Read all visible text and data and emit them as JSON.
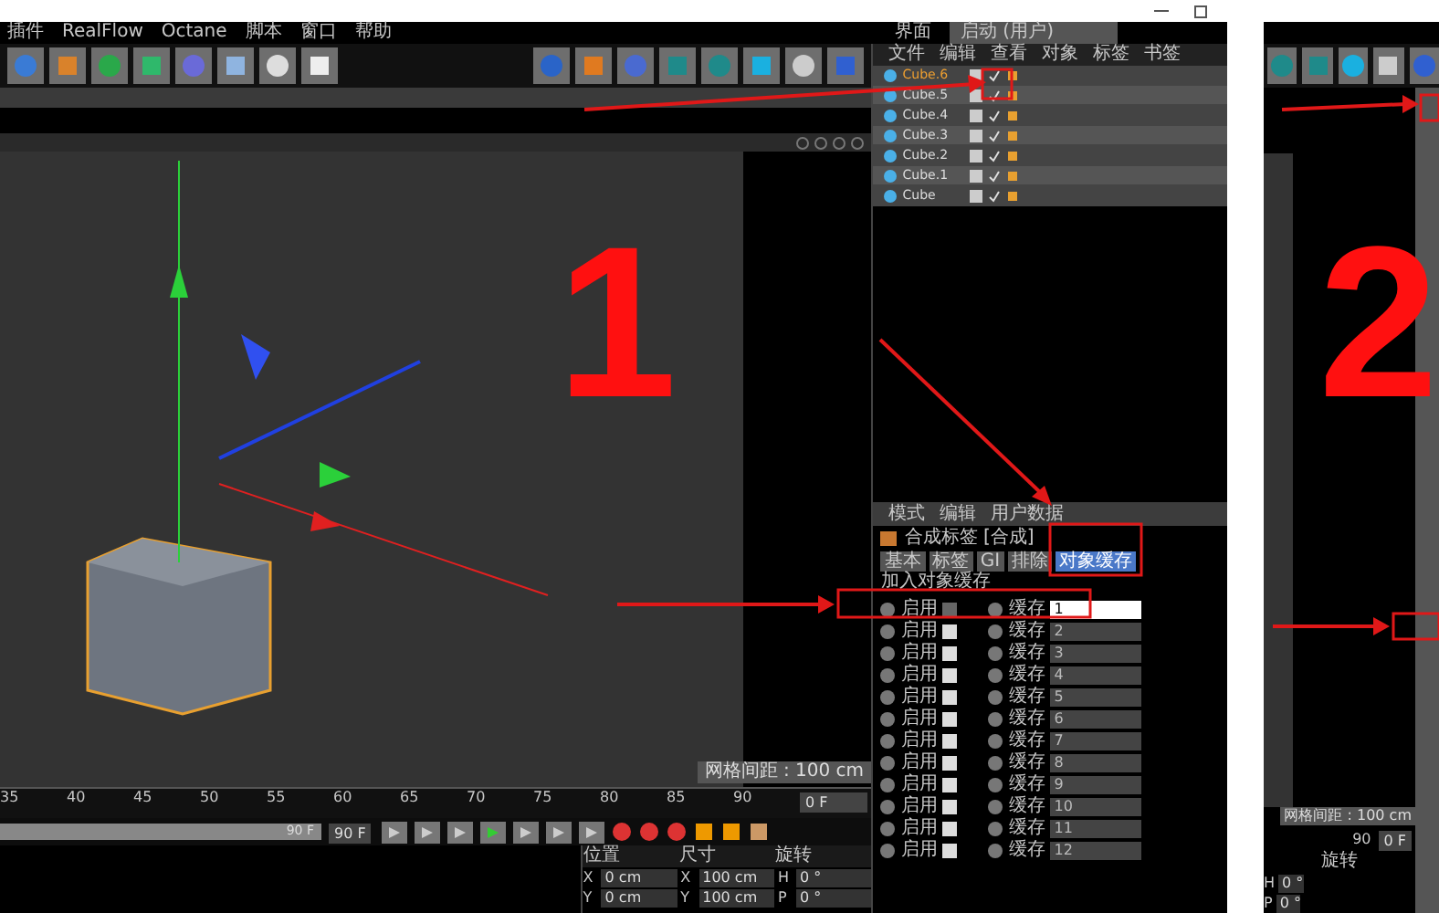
{
  "menu_bar": {
    "items": [
      "插件",
      "RealFlow",
      "Octane",
      "脚本",
      "窗口",
      "帮助"
    ],
    "layout_label": "界面",
    "layout_value": "启动 (用户)"
  },
  "object_manager": {
    "tabs": [
      "文件",
      "编辑",
      "查看",
      "对象",
      "标签",
      "书签"
    ],
    "objects": [
      {
        "name": "Cube.6",
        "selected": true
      },
      {
        "name": "Cube.5",
        "selected": false
      },
      {
        "name": "Cube.4",
        "selected": false
      },
      {
        "name": "Cube.3",
        "selected": false
      },
      {
        "name": "Cube.2",
        "selected": false
      },
      {
        "name": "Cube.1",
        "selected": false
      },
      {
        "name": "Cube",
        "selected": false
      }
    ]
  },
  "viewport": {
    "grid_spacing": "网格间距 : 100 cm"
  },
  "attribute_manager": {
    "menu": [
      "模式",
      "编辑",
      "用户数据"
    ],
    "title": "合成标签 [合成]",
    "tabs": [
      {
        "label": "基本",
        "selected": false
      },
      {
        "label": "标签",
        "selected": false
      },
      {
        "label": "GI",
        "selected": false
      },
      {
        "label": "排除",
        "selected": false
      },
      {
        "label": "对象缓存",
        "selected": true
      }
    ],
    "section": "加入对象缓存",
    "rows": [
      {
        "enable_label": "启用",
        "checked": true,
        "cache_label": "缓存",
        "value": "1",
        "disabled": false
      },
      {
        "enable_label": "启用",
        "checked": false,
        "cache_label": "缓存",
        "value": "2",
        "disabled": true
      },
      {
        "enable_label": "启用",
        "checked": false,
        "cache_label": "缓存",
        "value": "3",
        "disabled": true
      },
      {
        "enable_label": "启用",
        "checked": false,
        "cache_label": "缓存",
        "value": "4",
        "disabled": true
      },
      {
        "enable_label": "启用",
        "checked": false,
        "cache_label": "缓存",
        "value": "5",
        "disabled": true
      },
      {
        "enable_label": "启用",
        "checked": false,
        "cache_label": "缓存",
        "value": "6",
        "disabled": true
      },
      {
        "enable_label": "启用",
        "checked": false,
        "cache_label": "缓存",
        "value": "7",
        "disabled": true
      },
      {
        "enable_label": "启用",
        "checked": false,
        "cache_label": "缓存",
        "value": "8",
        "disabled": true
      },
      {
        "enable_label": "启用",
        "checked": false,
        "cache_label": "缓存",
        "value": "9",
        "disabled": true
      },
      {
        "enable_label": "启用",
        "checked": false,
        "cache_label": "缓存",
        "value": "10",
        "disabled": true
      },
      {
        "enable_label": "启用",
        "checked": false,
        "cache_label": "缓存",
        "value": "11",
        "disabled": true
      },
      {
        "enable_label": "启用",
        "checked": false,
        "cache_label": "缓存",
        "value": "12",
        "disabled": true
      }
    ]
  },
  "timeline": {
    "ticks": [
      "35",
      "40",
      "45",
      "50",
      "55",
      "60",
      "65",
      "70",
      "75",
      "80",
      "85",
      "90"
    ],
    "current_frame": "0 F",
    "range_slider": {
      "level": 1,
      "label": "90 F"
    },
    "end_frame": "90 F"
  },
  "coordinates": {
    "headers": [
      "位置",
      "尺寸",
      "旋转"
    ],
    "rows": [
      {
        "axis": "X",
        "position": "0 cm",
        "size_axis": "X",
        "size": "100 cm",
        "rotation_axis": "H",
        "rotation": "0 °"
      },
      {
        "axis": "Y",
        "position": "0 cm",
        "size_axis": "Y",
        "size": "100 cm",
        "rotation_axis": "P",
        "rotation": "0 °"
      }
    ]
  },
  "annotation": {
    "step": "1"
  },
  "second_screenshot": {
    "step": "2",
    "grid_spacing": "网格间距 : 100 cm",
    "tick": "90",
    "current_frame": "0 F",
    "rotation_header": "旋转",
    "rotation_rows": [
      {
        "axis": "H",
        "value": "0 °"
      },
      {
        "axis": "P",
        "value": "0 °"
      }
    ]
  }
}
